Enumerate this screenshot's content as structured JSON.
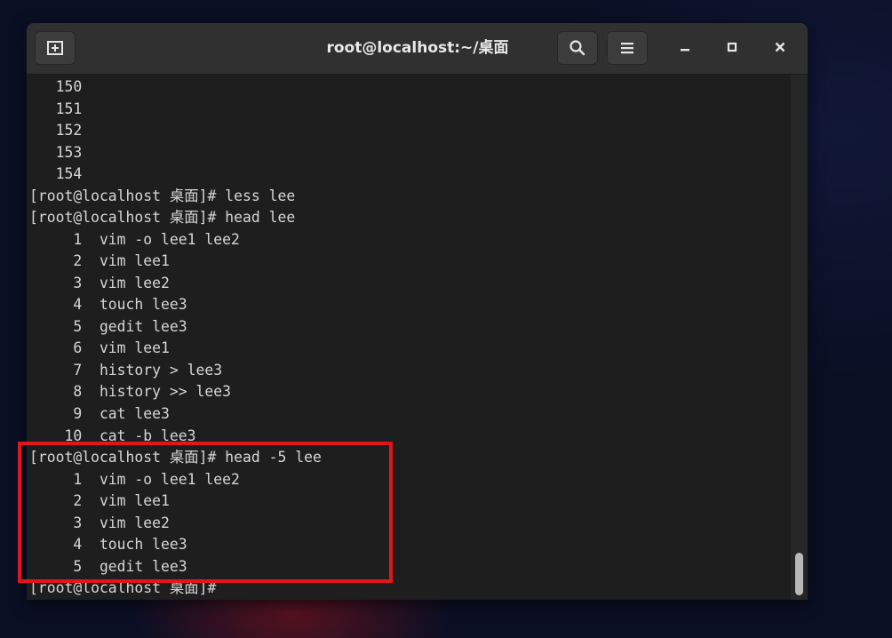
{
  "window": {
    "title": "root@localhost:~/桌面",
    "icons": {
      "new_tab": "new-tab-icon",
      "search": "search-icon",
      "menu": "hamburger-menu-icon",
      "minimize": "minimize-icon",
      "maximize": "maximize-icon",
      "close": "close-icon"
    }
  },
  "terminal": {
    "lines": [
      "   150",
      "   151",
      "   152",
      "   153",
      "   154",
      "[root@localhost 桌面]# less lee",
      "[root@localhost 桌面]# head lee",
      "     1  vim -o lee1 lee2",
      "     2  vim lee1",
      "     3  vim lee2",
      "     4  touch lee3",
      "     5  gedit lee3",
      "     6  vim lee1",
      "     7  history > lee3",
      "     8  history >> lee3",
      "     9  cat lee3",
      "    10  cat -b lee3",
      "[root@localhost 桌面]# head -5 lee",
      "     1  vim -o lee1 lee2",
      "     2  vim lee1",
      "     3  vim lee2",
      "     4  touch lee3",
      "     5  gedit lee3",
      "[root@localhost 桌面]# "
    ]
  },
  "colors": {
    "highlight_box": "#e2151b",
    "terminal_bg": "#1e1e1e",
    "titlebar_bg": "#303030"
  }
}
